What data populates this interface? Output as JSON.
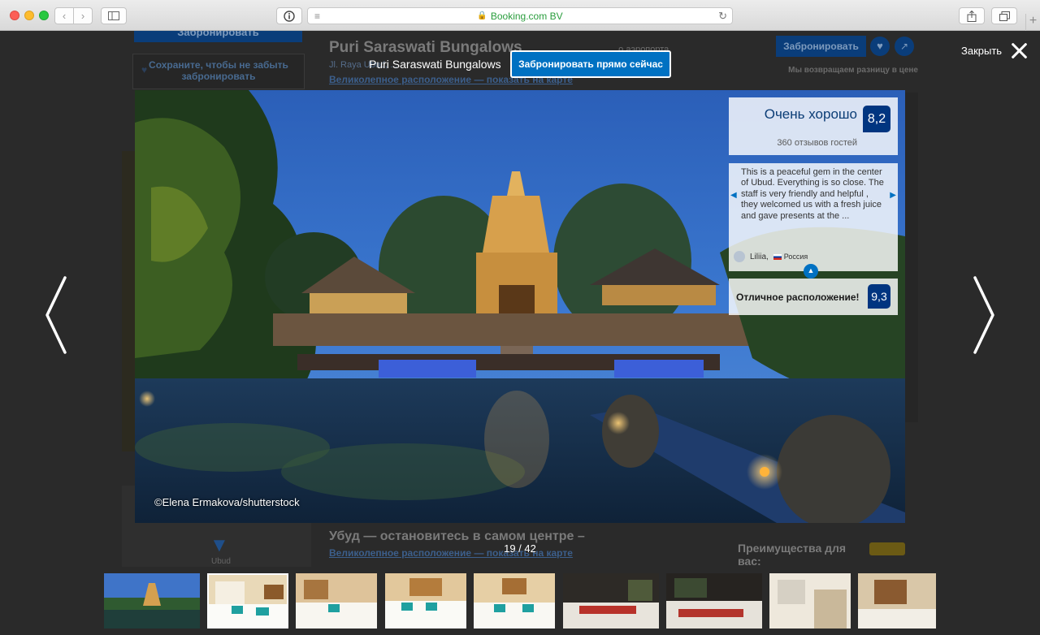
{
  "browser": {
    "url_text": "Booking.com BV",
    "sidebar_icon": "sidebar-icon",
    "reader_icon": "reader-icon",
    "share_icon": "share-icon",
    "tabs_icon": "tabs-icon"
  },
  "background_page": {
    "book_button_label": "Забронировать",
    "save_label": "Сохраните, чтобы не забыть забронировать",
    "hotel_title": "Puri Saraswati Bungalows",
    "address_text": "Jl. Raya Ubud, ...",
    "location_link": "Великолепное расположение — показать на карте",
    "airport_text": "...о аэропорта",
    "book_right_label": "Забронировать",
    "guarantee_text": "Мы возвращаем разницу в цене",
    "map_label": "Ubud",
    "ubud_title": "Убуд — остановитесь в самом центре –",
    "ubud_link": "Великолепное расположение — показать на карте",
    "perks_title": "Преимущества для вас:"
  },
  "overlay": {
    "hotel_name": "Puri Saraswati Bungalows",
    "book_now_label": "Забронировать прямо сейчас",
    "close_label": "Закрыть",
    "photo_credit": "©Elena Ermakova/shutterstock",
    "counter": "19 / 42"
  },
  "reviews": {
    "score_words": "Очень хорошо",
    "score": "8,2",
    "review_count": "360 отзывов гостей",
    "review_text": "This is a peaceful gem in the center of Ubud. Everything is so close. The staff is very friendly and helpful , they welcomed us with a fresh juice and gave presents at the ...",
    "reviewer_name": "Liliia,",
    "reviewer_country": "Россия",
    "location_label": "Отличное расположение!",
    "location_score": "9,3"
  },
  "thumbnails": [
    {
      "kind": "temple"
    },
    {
      "kind": "room-light",
      "active": true
    },
    {
      "kind": "room-light"
    },
    {
      "kind": "room-light"
    },
    {
      "kind": "room-light"
    },
    {
      "kind": "room-dark"
    },
    {
      "kind": "room-dark"
    },
    {
      "kind": "bathroom"
    },
    {
      "kind": "bathroom"
    }
  ],
  "colors": {
    "brand_blue": "#0071c2",
    "score_navy": "#003580",
    "overlay_bg": "#1a1a1a"
  }
}
